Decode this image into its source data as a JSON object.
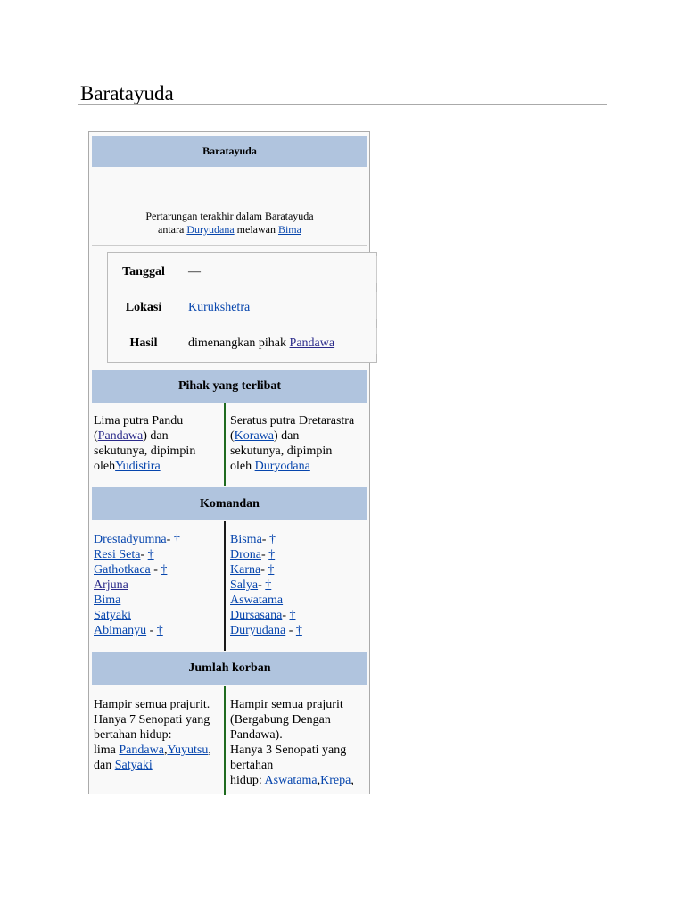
{
  "page": {
    "title": "Baratayuda"
  },
  "infobox": {
    "title": "Baratayuda",
    "caption": {
      "line1": "Pertarungan terakhir dalam Baratayuda",
      "line2_prefix": "antara ",
      "link1": "Duryudana",
      "middle": " melawan ",
      "link2": "Bima"
    },
    "facts": [
      {
        "label": "Tanggal",
        "value": "—"
      },
      {
        "label": "Lokasi",
        "value_link": "Kurukshetra"
      },
      {
        "label": "Hasil",
        "value_prefix": "dimenangkan pihak ",
        "value_link": "Pandawa"
      }
    ],
    "sections": {
      "pihak": {
        "heading": "Pihak yang terlibat",
        "left": {
          "l1": "Lima putra Pandu",
          "l2_open": "(",
          "l2_link": "Pandawa",
          "l2_rest": ") dan",
          "l3": "sekutunya, dipimpin",
          "l4_prefix": "oleh",
          "l4_link": "Yudistira"
        },
        "right": {
          "l1": "Seratus putra Dretarastra",
          "l2_open": "(",
          "l2_link": "Korawa",
          "l2_rest": ") dan",
          "l3": "sekutunya, dipimpin",
          "l4_prefix": "oleh ",
          "l4_link": "Duryodana"
        }
      },
      "komandan": {
        "heading": "Komandan",
        "left": [
          {
            "name": "Drestadyumna",
            "sep": "- ",
            "dagger": "†"
          },
          {
            "name": "Resi Seta",
            "sep": "- ",
            "dagger": "†"
          },
          {
            "name": "Gathotkaca",
            "sep": " - ",
            "dagger": "†"
          },
          {
            "name": "Arjuna",
            "sep": "",
            "dagger": ""
          },
          {
            "name": "Bima",
            "sep": "",
            "dagger": ""
          },
          {
            "name": "Satyaki",
            "sep": "",
            "dagger": ""
          },
          {
            "name": "Abimanyu",
            "sep": " - ",
            "dagger": "†"
          }
        ],
        "right": [
          {
            "name": "Bisma",
            "sep": "- ",
            "dagger": "†"
          },
          {
            "name": "Drona",
            "sep": "- ",
            "dagger": "†"
          },
          {
            "name": "Karna",
            "sep": "- ",
            "dagger": "†"
          },
          {
            "name": "Salya",
            "sep": "- ",
            "dagger": "†"
          },
          {
            "name": "Aswatama",
            "sep": "",
            "dagger": ""
          },
          {
            "name": "Dursasana",
            "sep": "- ",
            "dagger": "†"
          },
          {
            "name": "Duryudana",
            "sep": " - ",
            "dagger": "†"
          }
        ]
      },
      "korban": {
        "heading": "Jumlah korban",
        "left": {
          "l1": "Hampir semua prajurit.",
          "l2": "Hanya 7 Senopati yang",
          "l3": "bertahan hidup:",
          "l4_prefix": "lima ",
          "l4_link1": "Pandawa",
          "l4_comma": ",",
          "l4_link2": "Yuyutsu",
          "l4_end": ",",
          "l5_prefix": "dan ",
          "l5_link": "Satyaki"
        },
        "right": {
          "l1": "Hampir semua prajurit",
          "l2": "(Bergabung Dengan",
          "l3": "Pandawa).",
          "l4": "Hanya 3 Senopati yang",
          "l5": "bertahan",
          "l6_prefix": "hidup: ",
          "l6_link1": "Aswatama",
          "l6_comma": ",",
          "l6_link2": "Krepa",
          "l6_end": ","
        }
      }
    }
  }
}
